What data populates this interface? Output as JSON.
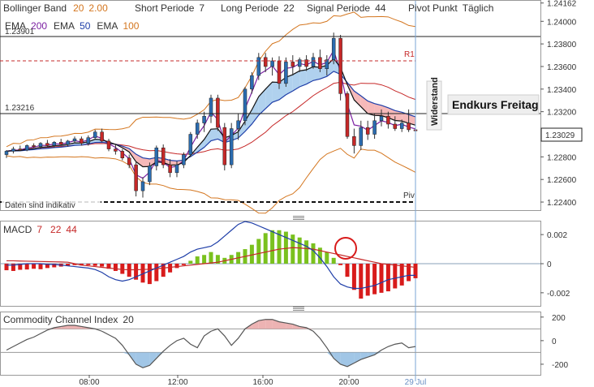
{
  "header": {
    "bb_label": "Bollinger Band",
    "bb_p1": "20",
    "bb_p2": "2.00",
    "short_label": "Short Periode",
    "short_val": "7",
    "long_label": "Long Periode",
    "long_val": "22",
    "signal_label": "Signal Periode",
    "signal_val": "44",
    "pivot_label": "Pivot Punkt",
    "pivot_val": "Täglich",
    "ema1_label": "EMA",
    "ema1_val": "200",
    "ema2_label": "EMA",
    "ema2_val": "50",
    "ema3_label": "EMA",
    "ema3_val": "100"
  },
  "annotations": {
    "level_high": "1.23901",
    "level_mid": "1.23216",
    "r1": "R1",
    "piv": "Piv",
    "indicative": "Daten sind indikativ",
    "widerstand": "Widerstand",
    "endkurs": "Endkurs Freitag",
    "last_price": "1.23029"
  },
  "macd": {
    "label": "MACD",
    "p1": "7",
    "p2": "22",
    "p3": "44"
  },
  "cci": {
    "label": "Commodity Channel Index",
    "p1": "20"
  },
  "colors": {
    "up": "#2b6cb0",
    "down": "#c62828",
    "bb": "#d4761f",
    "ema_slow": "#7b1fa2",
    "ema_mid": "#1e3ea8",
    "ema_fast": "#111111",
    "cloud_up": "#9cc6ea",
    "cloud_down": "#f4a7a7",
    "macd_pos": "#7ac11e",
    "macd_neg": "#d81b1b",
    "cci_pos": "#e8a0a0",
    "cci_neg": "#8ab8e0"
  },
  "chart_data": [
    {
      "type": "candlestick",
      "x_ticks": [
        "08:00",
        "12:00",
        "16:00",
        "20:00",
        "29 Jul"
      ],
      "y_ticks": [
        "1.24162",
        "1.24000",
        "1.23800",
        "1.23600",
        "1.23400",
        "1.23200",
        "1.22800",
        "1.22600",
        "1.22400"
      ],
      "ylim": [
        1.2235,
        1.2416
      ],
      "horizontal_levels": {
        "1.23901": 1.23901,
        "1.23216": 1.23216,
        "R1": 1.2372,
        "Piv": 1.2242
      },
      "candles": [
        [
          1.2282,
          1.2286,
          1.2279,
          1.2285
        ],
        [
          1.2285,
          1.2289,
          1.2283,
          1.2287
        ],
        [
          1.2287,
          1.229,
          1.2285,
          1.2286
        ],
        [
          1.2286,
          1.2291,
          1.2285,
          1.229
        ],
        [
          1.229,
          1.2292,
          1.2288,
          1.2289
        ],
        [
          1.2289,
          1.2293,
          1.2287,
          1.2292
        ],
        [
          1.2292,
          1.2295,
          1.2289,
          1.229
        ],
        [
          1.229,
          1.2294,
          1.2288,
          1.2293
        ],
        [
          1.2293,
          1.2296,
          1.229,
          1.2291
        ],
        [
          1.2291,
          1.2295,
          1.2289,
          1.2294
        ],
        [
          1.2294,
          1.2298,
          1.2292,
          1.2296
        ],
        [
          1.2296,
          1.2298,
          1.229,
          1.2292
        ],
        [
          1.2292,
          1.2299,
          1.229,
          1.2297
        ],
        [
          1.2297,
          1.2304,
          1.2295,
          1.2302
        ],
        [
          1.2302,
          1.2305,
          1.2293,
          1.2294
        ],
        [
          1.2294,
          1.2296,
          1.2285,
          1.2287
        ],
        [
          1.2287,
          1.2291,
          1.2282,
          1.2285
        ],
        [
          1.2285,
          1.2287,
          1.2277,
          1.2279
        ],
        [
          1.2279,
          1.2282,
          1.227,
          1.2273
        ],
        [
          1.2273,
          1.2276,
          1.2245,
          1.225
        ],
        [
          1.225,
          1.2262,
          1.2244,
          1.2258
        ],
        [
          1.2258,
          1.2275,
          1.2255,
          1.2272
        ],
        [
          1.2272,
          1.229,
          1.2268,
          1.2288
        ],
        [
          1.2288,
          1.2291,
          1.227,
          1.2273
        ],
        [
          1.2273,
          1.2278,
          1.2262,
          1.2266
        ],
        [
          1.2266,
          1.2276,
          1.2262,
          1.2273
        ],
        [
          1.2273,
          1.2284,
          1.227,
          1.2282
        ],
        [
          1.2282,
          1.2302,
          1.228,
          1.23
        ],
        [
          1.23,
          1.2313,
          1.2296,
          1.231
        ],
        [
          1.231,
          1.232,
          1.2302,
          1.2316
        ],
        [
          1.2316,
          1.2335,
          1.231,
          1.2332
        ],
        [
          1.2332,
          1.2335,
          1.2303,
          1.2306
        ],
        [
          1.2306,
          1.231,
          1.2268,
          1.2273
        ],
        [
          1.2273,
          1.231,
          1.227,
          1.2305
        ],
        [
          1.2305,
          1.2318,
          1.2295,
          1.2312
        ],
        [
          1.2312,
          1.2342,
          1.2308,
          1.234
        ],
        [
          1.234,
          1.2355,
          1.2336,
          1.2352
        ],
        [
          1.2352,
          1.2372,
          1.2348,
          1.2368
        ],
        [
          1.2368,
          1.2372,
          1.2355,
          1.236
        ],
        [
          1.236,
          1.2368,
          1.2352,
          1.2365
        ],
        [
          1.2365,
          1.2369,
          1.234,
          1.2345
        ],
        [
          1.2345,
          1.2368,
          1.2342,
          1.2364
        ],
        [
          1.2364,
          1.237,
          1.2352,
          1.236
        ],
        [
          1.236,
          1.2368,
          1.2355,
          1.2366
        ],
        [
          1.2366,
          1.237,
          1.2356,
          1.236
        ],
        [
          1.236,
          1.2372,
          1.2358,
          1.2368
        ],
        [
          1.2368,
          1.2375,
          1.2355,
          1.2358
        ],
        [
          1.2358,
          1.237,
          1.2352,
          1.2366
        ],
        [
          1.2366,
          1.239,
          1.2362,
          1.2385
        ],
        [
          1.2385,
          1.2388,
          1.233,
          1.2336
        ],
        [
          1.2336,
          1.2338,
          1.2296,
          1.2298
        ],
        [
          1.2298,
          1.2305,
          1.2283,
          1.229
        ],
        [
          1.229,
          1.2312,
          1.2286,
          1.2306
        ],
        [
          1.2306,
          1.2312,
          1.2295,
          1.23
        ],
        [
          1.23,
          1.2318,
          1.2296,
          1.2312
        ],
        [
          1.2312,
          1.2322,
          1.2307,
          1.2316
        ],
        [
          1.2316,
          1.232,
          1.2305,
          1.2309
        ],
        [
          1.2309,
          1.2316,
          1.2303,
          1.2305
        ],
        [
          1.2305,
          1.2313,
          1.2302,
          1.231
        ],
        [
          1.231,
          1.2322,
          1.2302,
          1.2304
        ],
        [
          1.2304,
          1.2307,
          1.23,
          1.2303
        ]
      ]
    },
    {
      "type": "bar",
      "title": "MACD",
      "y_ticks": [
        "0.002",
        "0",
        "-0.002"
      ],
      "ylim": [
        -0.0029,
        0.0029
      ],
      "histogram": [
        -0.00045,
        -0.0005,
        -0.00042,
        -0.0004,
        -0.00035,
        -0.00038,
        -0.0003,
        -0.00025,
        -0.0002,
        -0.00015,
        -0.0001,
        -0.00012,
        -0.0001,
        -0.00015,
        -0.0002,
        -0.00035,
        -0.0005,
        -0.0007,
        -0.0009,
        -0.0011,
        -0.0013,
        -0.0014,
        -0.0012,
        -0.0009,
        -0.0006,
        -0.0003,
        -0.0001,
        0.0002,
        0.0005,
        0.0006,
        0.0008,
        0.0006,
        0.0004,
        0.0006,
        0.0008,
        0.001,
        0.0013,
        0.0017,
        0.0021,
        0.0023,
        0.0023,
        0.0022,
        0.002,
        0.0018,
        0.0016,
        0.0014,
        0.0011,
        0.0008,
        0.0004,
        -0.0001,
        -0.0009,
        -0.0018,
        -0.0024,
        -0.0022,
        -0.0021,
        -0.002,
        -0.0019,
        -0.0017,
        -0.0015,
        -0.0012,
        -0.001
      ],
      "macd_line": [
        -0.0001,
        -0.0001,
        -5e-05,
        0.0,
        0.0,
        0.0,
        -5e-05,
        -5e-05,
        -0.0001,
        -0.00015,
        -0.0002,
        -0.00025,
        -0.0003,
        -0.0004,
        -0.0006,
        -0.0009,
        -0.0011,
        -0.0012,
        -0.0011,
        -0.0009,
        -0.0007,
        -0.0005,
        -0.0003,
        -0.0001,
        0.0001,
        0.0003,
        0.0005,
        0.0008,
        0.001,
        0.0011,
        0.0012,
        0.0015,
        0.0019,
        0.0023,
        0.0027,
        0.0029,
        0.0028,
        0.0026,
        0.0024,
        0.0022,
        0.002,
        0.0018,
        0.0016,
        0.0014,
        0.0012,
        0.0009,
        0.0004,
        -0.0002,
        -0.0009,
        -0.0014,
        -0.0016,
        -0.0017,
        -0.0017,
        -0.0016,
        -0.0015,
        -0.0013,
        -0.0011,
        -0.001,
        -0.0009,
        -0.0008,
        -0.0008
      ],
      "signal_line": [
        0.0002,
        0.0002,
        0.00018,
        0.00017,
        0.00016,
        0.00015,
        0.00014,
        0.00013,
        0.00012,
        0.0001,
        0.0,
        -0.0001,
        -0.00015,
        -0.0002,
        -0.00025,
        -0.0003,
        -0.00035,
        -0.0004,
        -0.00042,
        -0.00042,
        -0.0004,
        -0.00038,
        -0.00035,
        -0.0003,
        -0.00025,
        -0.0002,
        -0.00015,
        -0.0001,
        -5e-05,
        0.0,
        5e-05,
        0.0001,
        0.0002,
        0.0003,
        0.0004,
        0.0005,
        0.0006,
        0.0007,
        0.0008,
        0.0009,
        0.001,
        0.00105,
        0.0011,
        0.00108,
        0.00104,
        0.001,
        0.0009,
        0.0008,
        0.0007,
        0.0006,
        0.0005,
        0.0004,
        0.0003,
        0.0002,
        0.0001,
        0.0,
        -5e-05,
        -0.0001,
        -0.00015,
        -0.0002,
        -0.00025
      ]
    },
    {
      "type": "line",
      "title": "Commodity Channel Index",
      "y_ticks": [
        "200",
        "0",
        "-200"
      ],
      "ylim": [
        -290,
        240
      ],
      "values": [
        -80,
        -50,
        -20,
        10,
        30,
        60,
        90,
        110,
        120,
        130,
        130,
        120,
        110,
        100,
        80,
        50,
        20,
        -40,
        -120,
        -200,
        -230,
        -210,
        -150,
        -90,
        -40,
        0,
        20,
        -30,
        -60,
        40,
        80,
        100,
        40,
        -40,
        20,
        100,
        140,
        170,
        180,
        180,
        160,
        150,
        140,
        120,
        110,
        80,
        20,
        -60,
        -150,
        -200,
        -220,
        -190,
        -160,
        -140,
        -120,
        -80,
        -50,
        -30,
        -20,
        -60,
        -50
      ]
    }
  ]
}
